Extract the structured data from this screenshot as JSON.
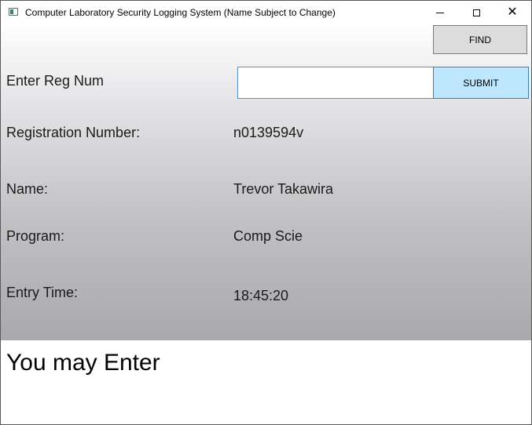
{
  "window": {
    "title": "Computer Laboratory Security Logging System (Name Subject to Change)",
    "icon": "app-window-icon"
  },
  "toolbar": {
    "find_label": "FIND"
  },
  "form": {
    "reg_prompt": "Enter Reg Num",
    "reg_input_value": "",
    "reg_input_placeholder": "",
    "submit_label": "SUBMIT"
  },
  "details": {
    "reg_label": "Registration Number:",
    "reg_value": "n0139594v",
    "name_label": "Name:",
    "name_value": "Trevor Takawira",
    "program_label": "Program:",
    "program_value": "Comp Scie",
    "entry_label": "Entry Time:",
    "entry_value": "18:45:20"
  },
  "status": {
    "message": "You may Enter"
  },
  "colors": {
    "submit_bg": "#bee6fd",
    "find_bg": "#dcdcdc",
    "input_border": "#5b8fd4"
  }
}
